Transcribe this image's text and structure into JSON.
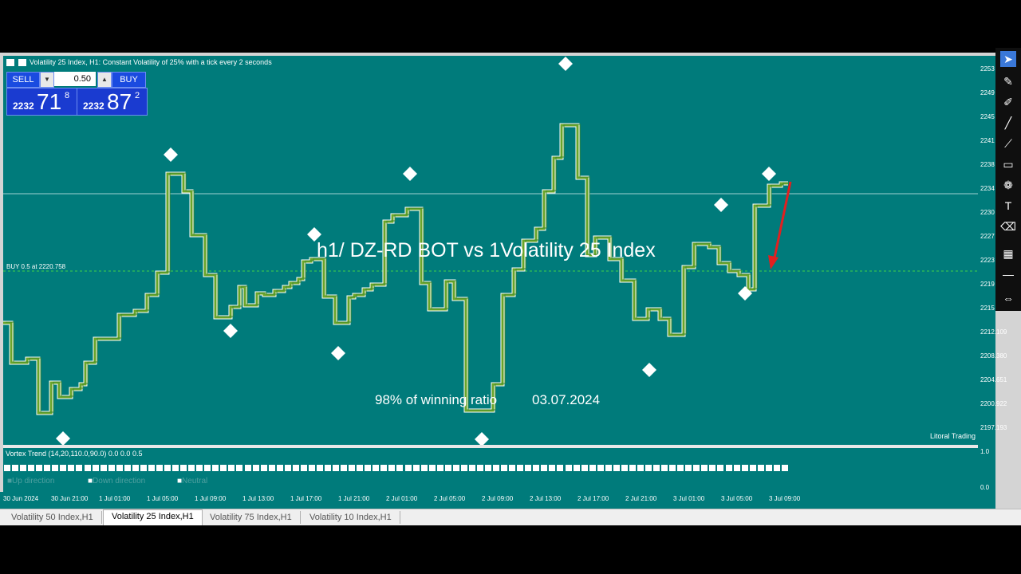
{
  "window": {
    "title": "Volatility 25 Index, H1:  Constant Volatility of 25% with a tick every 2 seconds"
  },
  "trade_panel": {
    "sell_label": "SELL",
    "buy_label": "BUY",
    "lot_value": "0.50",
    "sell_price_prefix": "2232",
    "sell_price_big": "71",
    "sell_price_sup": "8",
    "buy_price_prefix": "2232",
    "buy_price_big": "87",
    "buy_price_sup": "2"
  },
  "chart": {
    "order_line_label": "BUY 0.5 at 2220.758",
    "overlay_text": "h1/ DZ-RD BOT vs 1Volatility 25 Index",
    "win_text": "98% of winning ratio",
    "date_text": "03.07.2024",
    "watermark": "Litoral Trading",
    "colors": {
      "background": "#007b7b",
      "up_line": "#6aa42a",
      "down_line": "#ffffff",
      "order_line": "#3fd24a",
      "arrow": "#e02020"
    }
  },
  "y_axis": {
    "labels": [
      "2253",
      "2249",
      "2245",
      "2241",
      "2238",
      "2234",
      "2230",
      "2227",
      "2223",
      "2219",
      "2215",
      "2212.109",
      "2208.380",
      "2204.651",
      "2200.922",
      "2197.193"
    ]
  },
  "x_axis": {
    "labels": [
      "30 Jun 2024",
      "30 Jun 21:00",
      "1 Jul 01:00",
      "1 Jul 05:00",
      "1 Jul 09:00",
      "1 Jul 13:00",
      "1 Jul 17:00",
      "1 Jul 21:00",
      "2 Jul 01:00",
      "2 Jul 05:00",
      "2 Jul 09:00",
      "2 Jul 13:00",
      "2 Jul 17:00",
      "2 Jul 21:00",
      "3 Jul 01:00",
      "3 Jul 05:00",
      "3 Jul 09:00"
    ]
  },
  "indicator": {
    "title": "Vortex Trend (14,20,110.0,90.0) 0.0 0.0 0.5",
    "scale_top": "1.0",
    "scale_bottom": "0.0",
    "legend": [
      "Up direction",
      "Down direction",
      "Neutral"
    ]
  },
  "tabs": [
    {
      "label": "Volatility 50 Index,H1",
      "active": false
    },
    {
      "label": "Volatility 25 Index,H1",
      "active": true
    },
    {
      "label": "Volatility 75 Index,H1",
      "active": false
    },
    {
      "label": "Volatility 10 Index,H1",
      "active": false
    }
  ],
  "tools": [
    "cursor-icon",
    "pencil-icon",
    "marker-icon",
    "line-icon",
    "brush-icon",
    "rectangle-icon",
    "shapes-icon",
    "text-icon",
    "eraser-icon",
    "checker-icon",
    "horizontal-line-icon",
    "arrows-icon"
  ]
}
